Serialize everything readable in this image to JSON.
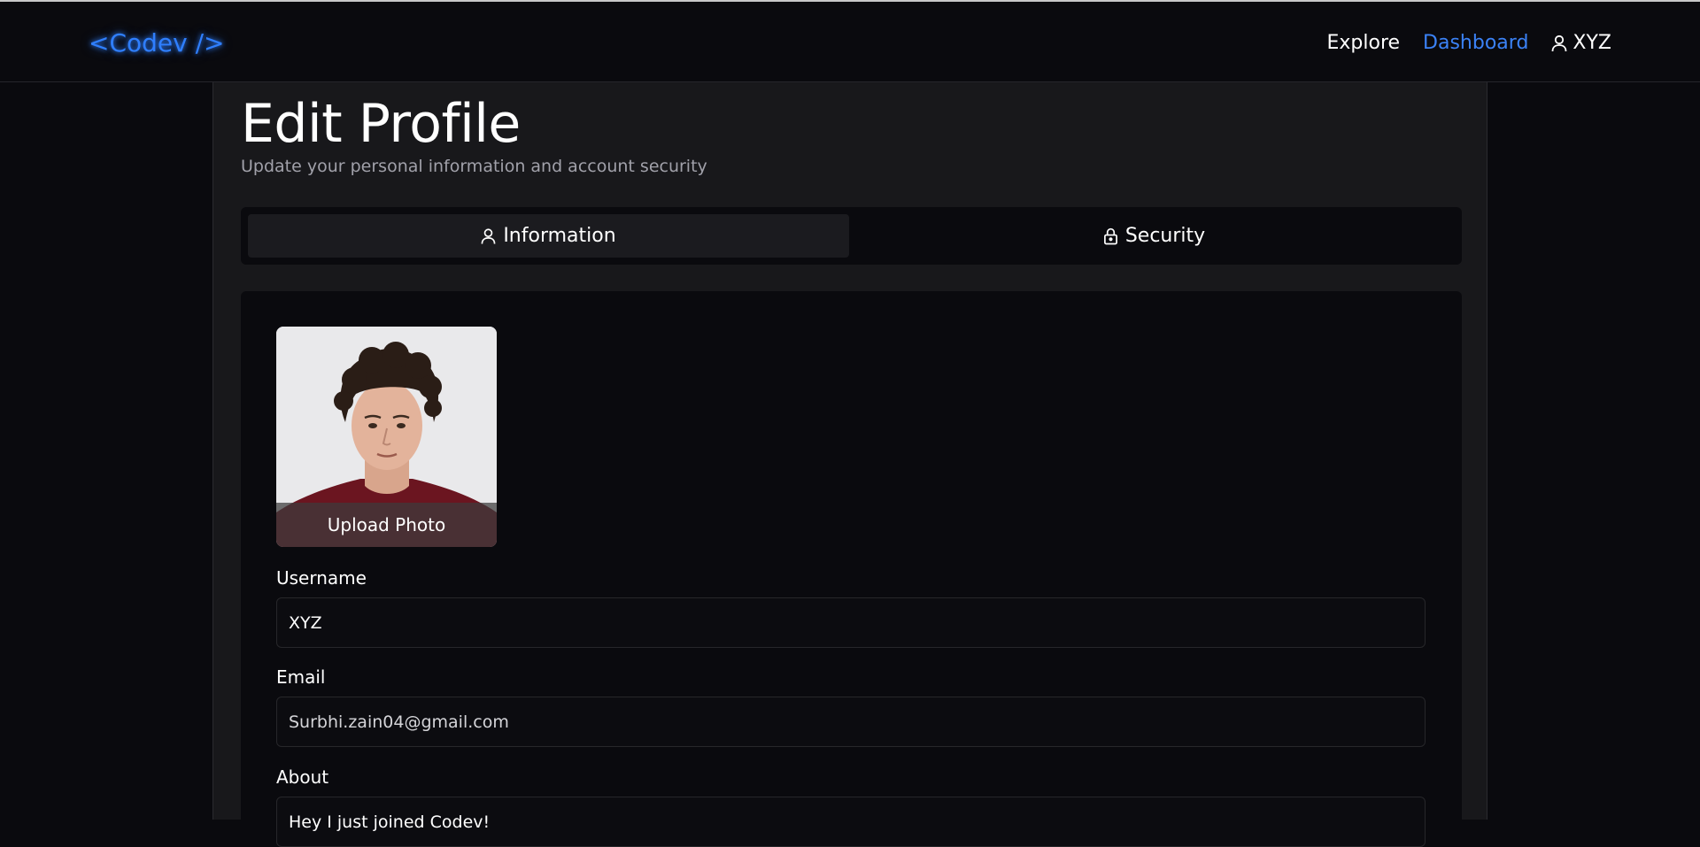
{
  "navbar": {
    "brand": "<Codev />",
    "links": {
      "explore": "Explore",
      "dashboard": "Dashboard"
    },
    "user": {
      "name": "XYZ",
      "icon": "user-icon"
    }
  },
  "page": {
    "title": "Edit Profile",
    "subtitle": "Update your personal information and account security"
  },
  "tabs": [
    {
      "label": "Information",
      "icon": "user-icon",
      "active": true
    },
    {
      "label": "Security",
      "icon": "lock-icon",
      "active": false
    }
  ],
  "profile": {
    "photo_overlay": "Upload Photo",
    "fields": {
      "username": {
        "label": "Username",
        "value": "XYZ"
      },
      "email": {
        "label": "Email",
        "value": "Surbhi.zain04@gmail.com"
      },
      "about": {
        "label": "About",
        "value": "Hey I just joined Codev!"
      }
    }
  },
  "colors": {
    "background": "#0a0a0e",
    "panel": "#18181b",
    "accent": "#3b82f6",
    "brand_glow": "#2f7fff"
  }
}
